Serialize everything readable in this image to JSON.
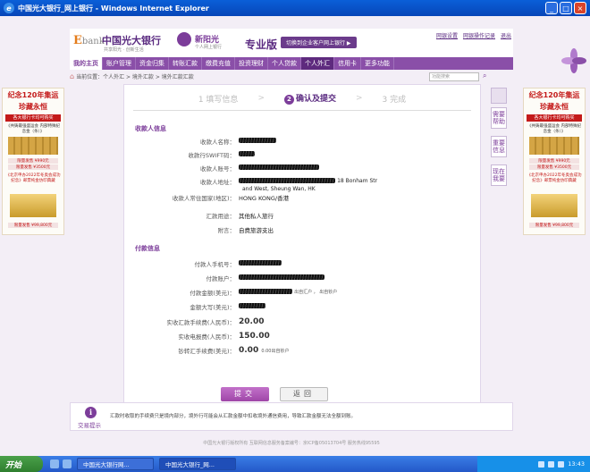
{
  "window": {
    "title": "中国光大银行_网上银行 - Windows Internet Explorer",
    "ie_icon": "e",
    "buttons": [
      "_",
      "□",
      "×"
    ]
  },
  "header": {
    "logo_letter": "E",
    "logo_rest": "bank",
    "bank_name": "中国光大银行",
    "bank_slogan": "共享阳光 · 创新生活",
    "new_sunshine": "新阳光",
    "new_sunshine_sub": "个人网上银行",
    "edition": "专业版",
    "switch_label": "切换到企业客户网上银行 ▶",
    "links": [
      "网银设置",
      "网银操作记录",
      "退出"
    ]
  },
  "nav": {
    "items": [
      "我的主页",
      "账户管理",
      "资金归集",
      "转账汇款",
      "缴费充值",
      "投资理财",
      "个人贷款",
      "个人外汇",
      "信用卡",
      "更多功能"
    ],
    "active_index": 0,
    "highlight_index": 7
  },
  "breadcrumb": {
    "text": "当前位置：个人外汇 > 境外汇款 > 境外汇款汇款",
    "search_placeholder": "功能搜索"
  },
  "banner": {
    "line1": "纪念120年集运",
    "line2": "珍藏永恒",
    "line3": "各大银行卡均可购买",
    "line4": "《共铸最强盛运会 内部特殊纪念金（条）》",
    "price1": "限量发售 ¥990元",
    "price2": "限量发售 ¥3500元",
    "line5": "《北京申办2022年冬奥会成功纪念》邮票纯金仿印典藏",
    "price3": "限量发售 ¥99,800元",
    "right_line2": "珍藏永恒"
  },
  "steps": {
    "items": [
      {
        "num": "1",
        "label": "填写信息"
      },
      {
        "num": "2",
        "label": "确认及提交"
      },
      {
        "num": "3",
        "label": "完成"
      }
    ],
    "active_index": 1,
    "separator": ">"
  },
  "payee": {
    "title": "收款人信息",
    "rows": [
      {
        "label": "收款人名称：",
        "value": ""
      },
      {
        "label": "收款行SWIFT码：",
        "value": ""
      },
      {
        "label": "收款人账号：",
        "value": ""
      },
      {
        "label": "收款人地址：",
        "value": "18 Bonham Str"
      },
      {
        "label": "收款人常住国家(地区)：",
        "value": "HONG KONG/香港"
      },
      {
        "label": "汇款用途：",
        "value": "其他私人旅行"
      },
      {
        "label": "附言：",
        "value": "自费旅游支出"
      }
    ],
    "address_line2": "and West, Sheung Wan, HK"
  },
  "payer": {
    "title": "付款信息",
    "rows": [
      {
        "label": "付款人手机号：",
        "value": ""
      },
      {
        "label": "付款账户：",
        "value": ""
      },
      {
        "label": "付款金额(美元)：",
        "value": "出自汇户 ，  出自钞户"
      },
      {
        "label": "金额大写(美元)：",
        "value": ""
      },
      {
        "label": "实收汇款手续费(人民币)：",
        "value": "20.00"
      },
      {
        "label": "实收电报费(人民币)：",
        "value": "150.00"
      },
      {
        "label": "钞转汇手续费(美元)：",
        "value": "0.00"
      }
    ],
    "fx_note": "0.00出自钞户"
  },
  "buttons": {
    "submit": "提交",
    "back": "返回"
  },
  "side_tabs": [
    "需要帮助",
    "重要信息",
    "现在我要"
  ],
  "tips": {
    "icon": "i",
    "label": "交易提示",
    "text": "汇款时收取的手续费只是境内部分，境外行可能会从汇款金额中扣收境外通信费用，导致汇款金额无法全额到账。"
  },
  "footer": "中国光大银行版权所有 互联网信息服务备案编号：京ICP备05013704号 服务热线95595",
  "taskbar": {
    "start": "开始",
    "tasks": [
      "中国光大银行网...",
      "中国光大银行_网..."
    ],
    "time": "13:43"
  }
}
